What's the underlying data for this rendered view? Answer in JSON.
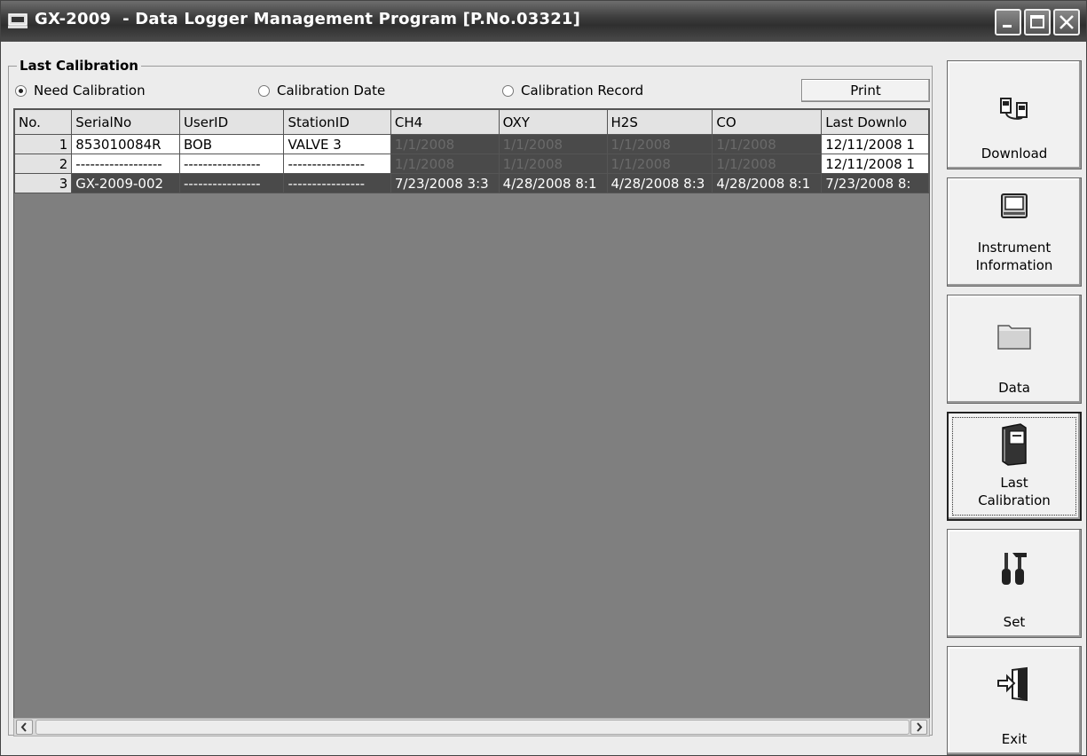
{
  "window": {
    "title": "GX-2009  - Data Logger Management Program [P.No.03321]"
  },
  "group": {
    "legend": "Last Calibration",
    "radios": [
      {
        "label": "Need Calibration",
        "selected": true
      },
      {
        "label": "Calibration Date",
        "selected": false
      },
      {
        "label": "Calibration Record",
        "selected": false
      }
    ],
    "print_label": "Print"
  },
  "table": {
    "headers": [
      "No.",
      "SerialNo",
      "UserID",
      "StationID",
      "CH4",
      "OXY",
      "H2S",
      "CO",
      "Last Downlo"
    ],
    "rows": [
      {
        "no": "1",
        "serial": "853010084R",
        "user": "BOB",
        "station": "VALVE 3",
        "ch4": "1/1/2008",
        "oxy": "1/1/2008",
        "h2s": "1/1/2008",
        "co": "1/1/2008",
        "last": "12/11/2008 1"
      },
      {
        "no": "2",
        "serial": "------------------",
        "user": "----------------",
        "station": "----------------",
        "ch4": "1/1/2008",
        "oxy": "1/1/2008",
        "h2s": "1/1/2008",
        "co": "1/1/2008",
        "last": "12/11/2008 1"
      },
      {
        "no": "3",
        "serial": "GX-2009-002",
        "user": "----------------",
        "station": "----------------",
        "ch4": "7/23/2008 3:3",
        "oxy": "4/28/2008 8:1",
        "h2s": "4/28/2008 8:3",
        "co": "4/28/2008 8:1",
        "last": "7/23/2008 8:"
      }
    ]
  },
  "sidebar": {
    "buttons": [
      {
        "label": "Download",
        "icon": "download-icon"
      },
      {
        "label": "Instrument\nInformation",
        "icon": "instrument-icon"
      },
      {
        "label": "Data",
        "icon": "folder-icon"
      },
      {
        "label": "Last\nCalibration",
        "icon": "calibration-book-icon",
        "active": true
      },
      {
        "label": "Set",
        "icon": "tools-icon"
      },
      {
        "label": "Exit",
        "icon": "exit-door-icon"
      }
    ]
  }
}
